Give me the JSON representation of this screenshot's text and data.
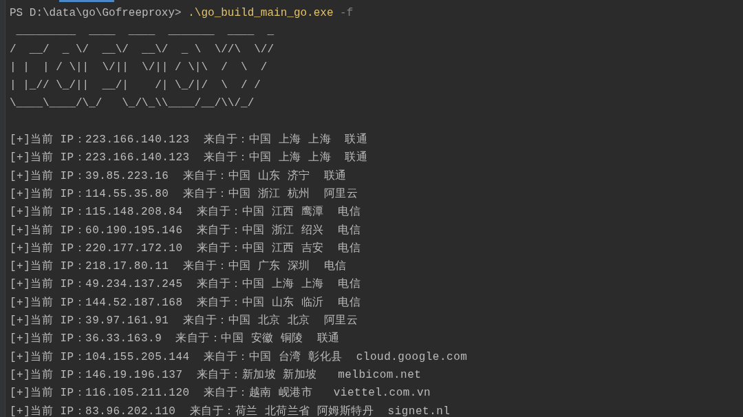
{
  "prompt": {
    "text": "PS D:\\data\\go\\Gofreeproxy> ",
    "command": ".\\go_build_main_go.exe",
    "flag": "-f"
  },
  "banner": [
    " _________  ____  ____  _______  ____  _",
    "/  __/  _ \\/  __\\/  __\\/  _ \\  \\//\\  \\//",
    "| |  | / \\||  \\/||  \\/|| / \\|\\  /  \\  /",
    "| |_// \\_/||  __/|    /| \\_/|/  \\  / /",
    "\\____\\____/\\_/   \\_/\\_\\\\____/__/\\\\/_/"
  ],
  "output": [
    "[+]当前 IP：223.166.140.123  来自于：中国 上海 上海  联通",
    "[+]当前 IP：223.166.140.123  来自于：中国 上海 上海  联通",
    "[+]当前 IP：39.85.223.16  来自于：中国 山东 济宁  联通",
    "[+]当前 IP：114.55.35.80  来自于：中国 浙江 杭州  阿里云",
    "[+]当前 IP：115.148.208.84  来自于：中国 江西 鹰潭  电信",
    "[+]当前 IP：60.190.195.146  来自于：中国 浙江 绍兴  电信",
    "[+]当前 IP：220.177.172.10  来自于：中国 江西 吉安  电信",
    "[+]当前 IP：218.17.80.11  来自于：中国 广东 深圳  电信",
    "[+]当前 IP：49.234.137.245  来自于：中国 上海 上海  电信",
    "[+]当前 IP：144.52.187.168  来自于：中国 山东 临沂  电信",
    "[+]当前 IP：39.97.161.91  来自于：中国 北京 北京  阿里云",
    "[+]当前 IP：36.33.163.9  来自于：中国 安徽 铜陵  联通",
    "[+]当前 IP：104.155.205.144  来自于：中国 台湾 彰化县  cloud.google.com",
    "[+]当前 IP：146.19.196.137  来自于：新加坡 新加坡   melbicom.net",
    "[+]当前 IP：116.105.211.120  来自于：越南 岘港市   viettel.com.vn",
    "[+]当前 IP：83.96.202.110  来自于：荷兰 北荷兰省 阿姆斯特丹  signet.nl"
  ]
}
